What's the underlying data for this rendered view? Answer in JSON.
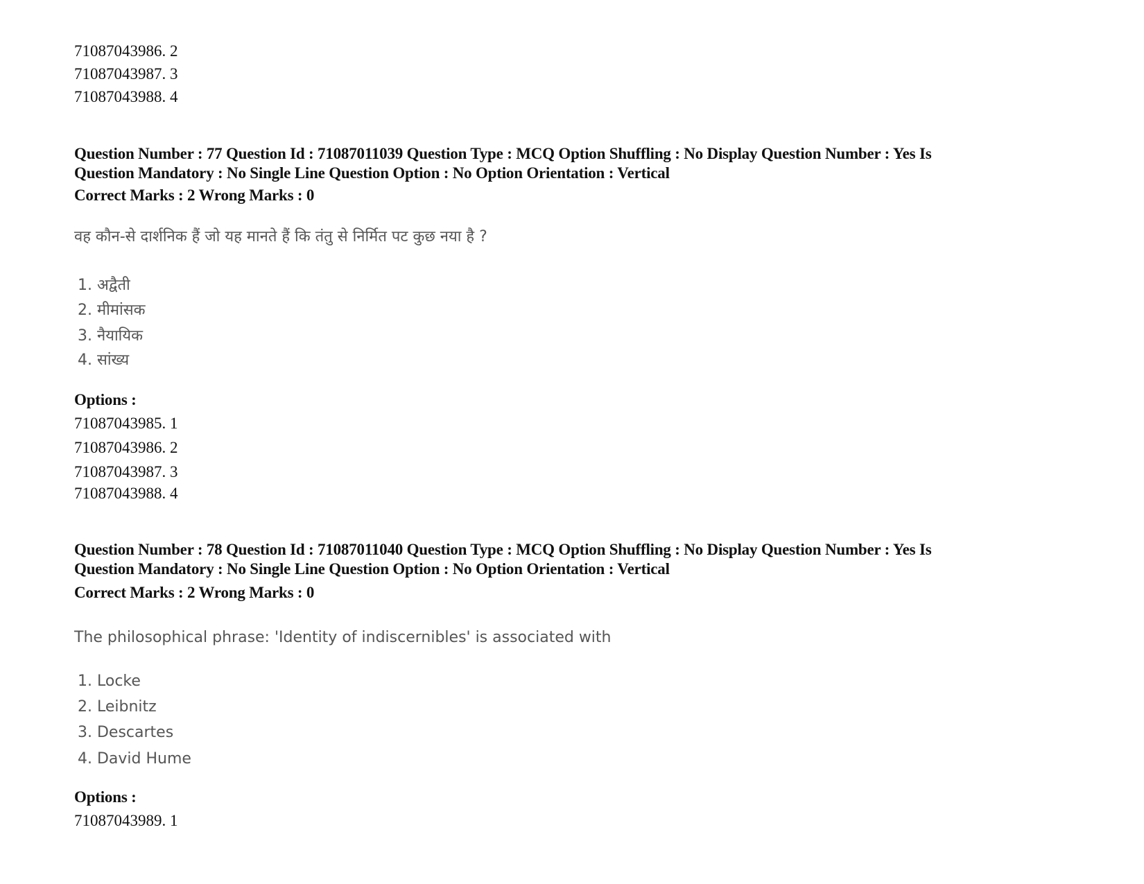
{
  "prev_options_tail": [
    {
      "id": "71087043986",
      "num": "2"
    },
    {
      "id": "71087043987",
      "num": "3"
    },
    {
      "id": "71087043988",
      "num": "4"
    }
  ],
  "questions": [
    {
      "header_line1": "Question Number : 77 Question Id : 71087011039 Question Type : MCQ Option Shuffling : No Display Question Number : Yes Is",
      "header_line2": "Question Mandatory : No Single Line Question Option : No Option Orientation : Vertical",
      "marks": "Correct Marks : 2 Wrong Marks : 0",
      "text": "वह कौन-से दार्शनिक हैं जो यह मानते हैं कि तंतु से निर्मित पट कुछ नया है ?",
      "choices": [
        "1. अद्वैती",
        "2. मीमांसक",
        "3. नैयायिक",
        "4. सांख्य"
      ],
      "options_label": "Options :",
      "options": [
        {
          "text": "71087043985. 1"
        },
        {
          "text": "71087043986. 2"
        },
        {
          "text": "71087043987. 3"
        },
        {
          "text": "71087043988. 4"
        }
      ]
    },
    {
      "header_line1": "Question Number : 78 Question Id : 71087011040 Question Type : MCQ Option Shuffling : No Display Question Number : Yes Is",
      "header_line2": "Question Mandatory : No Single Line Question Option : No Option Orientation : Vertical",
      "marks": "Correct Marks : 2 Wrong Marks : 0",
      "text": "The philosophical phrase: 'Identity of indiscernibles' is associated with",
      "choices": [
        "1. Locke",
        "2. Leibnitz",
        "3. Descartes",
        "4. David Hume"
      ],
      "options_label": "Options :",
      "options": [
        {
          "text": "71087043989. 1"
        }
      ]
    }
  ],
  "prev_tail_text": [
    "71087043986. 2",
    "71087043987. 3",
    "71087043988. 4"
  ]
}
